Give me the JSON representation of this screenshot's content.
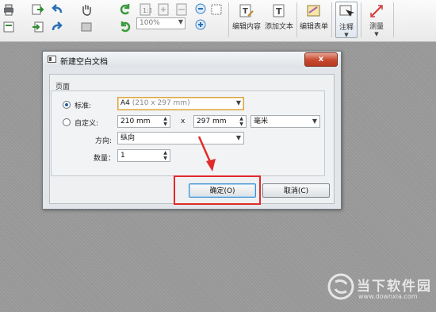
{
  "toolbar": {
    "zoom_value": "100%",
    "buttons": [
      {
        "label": "编辑内容",
        "icon": "edit-content-icon"
      },
      {
        "label": "添加文本",
        "icon": "add-text-icon"
      },
      {
        "label": "编辑表单",
        "icon": "edit-form-icon"
      },
      {
        "label": "注释",
        "icon": "annotate-icon"
      },
      {
        "label": "测量",
        "icon": "measure-icon"
      }
    ]
  },
  "dialog": {
    "title": "新建空白文档",
    "close_label": "x",
    "group_title": "页面",
    "standard_label": "标准:",
    "standard_value": "A4",
    "standard_hint": "(210 x 297 mm)",
    "custom_label": "自定义:",
    "width_value": "210 mm",
    "times_sign": "x",
    "height_value": "297 mm",
    "unit_value": "毫米",
    "orientation_label": "方向:",
    "orientation_value": "纵向",
    "quantity_label": "数量：",
    "quantity_value": "1",
    "ok_label": "确定(O)",
    "cancel_label": "取消(C)"
  },
  "watermark": {
    "site_name": "当下软件园",
    "site_url": "www.downxia.com"
  },
  "colors": {
    "annotation_red": "#e22a2a",
    "accent_blue": "#1f5fa8"
  }
}
